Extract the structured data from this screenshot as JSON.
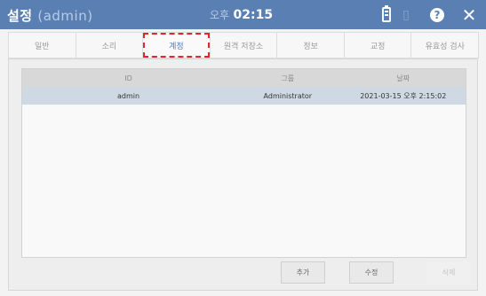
{
  "titlebar": {
    "title": "설정",
    "user": "(admin)",
    "ampm": "오후",
    "time": "02:15"
  },
  "icons": {
    "battery": "battery-icon",
    "help": "help-icon",
    "close": "close-icon",
    "help_glyph": "?",
    "close_glyph": "✕",
    "separator_glyph": "▯"
  },
  "tabs": [
    {
      "label": "일반"
    },
    {
      "label": "소리"
    },
    {
      "label": "계정"
    },
    {
      "label": "원격 저장소"
    },
    {
      "label": "정보"
    },
    {
      "label": "교정"
    },
    {
      "label": "유효성 검사"
    }
  ],
  "active_tab_index": 2,
  "table": {
    "headers": {
      "id": "ID",
      "group": "그룹",
      "date": "날짜"
    },
    "rows": [
      {
        "id": "admin",
        "group": "Administrator",
        "date": "2021-03-15 오후 2:15:02"
      }
    ]
  },
  "buttons": {
    "add": "추가",
    "edit": "수정",
    "delete": "삭제"
  },
  "colors": {
    "titlebar": "#5a7fb2",
    "active_tab_text": "#4a79c4",
    "highlight_dash": "#e0262e",
    "selected_row": "#cfd9e4"
  }
}
